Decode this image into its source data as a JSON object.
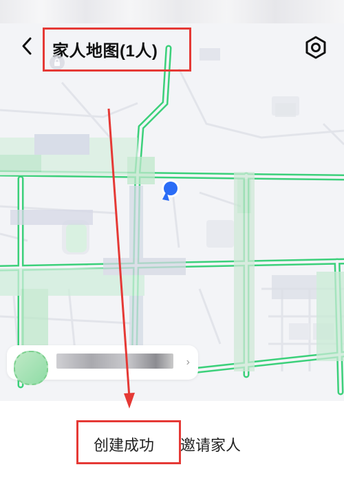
{
  "header": {
    "title": "家人地图(1人)",
    "back_icon": "chevron-left-icon",
    "settings_icon": "hexagon-gear-icon"
  },
  "map": {
    "background_color": "#f3f4f7",
    "road_color": "#3bd07a",
    "location_pin_color": "#2a6cf6"
  },
  "bottom": {
    "status": "创建成功",
    "invite": "邀请家人"
  },
  "annotations": {
    "highlight_color": "#e53935"
  }
}
